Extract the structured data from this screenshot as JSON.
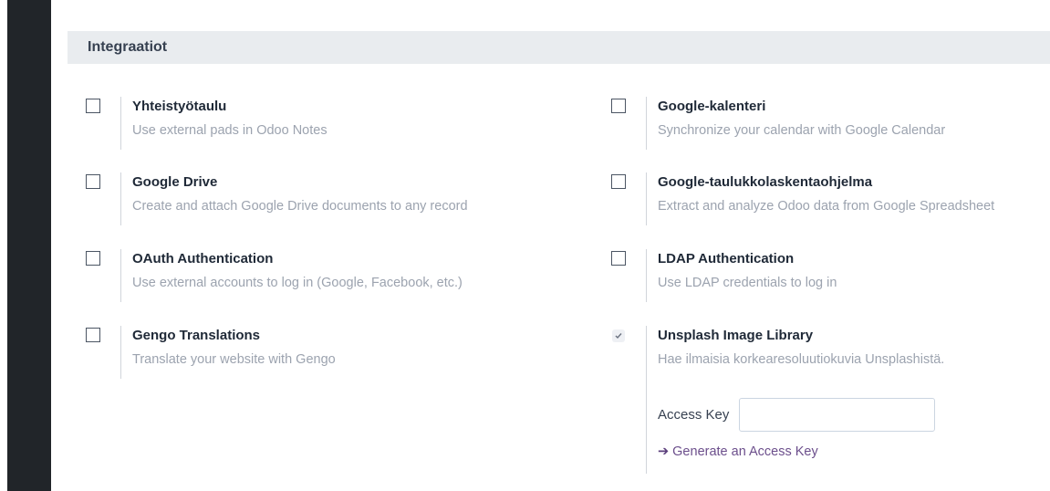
{
  "section": {
    "title": "Integraatiot"
  },
  "left_settings": [
    {
      "title": "Yhteistyötaulu",
      "description": "Use external pads in Odoo Notes",
      "checked": false
    },
    {
      "title": "Google Drive",
      "description": "Create and attach Google Drive documents to any record",
      "checked": false
    },
    {
      "title": "OAuth Authentication",
      "description": "Use external accounts to log in (Google, Facebook, etc.)",
      "checked": false
    },
    {
      "title": "Gengo Translations",
      "description": "Translate your website with Gengo",
      "checked": false
    }
  ],
  "right_settings": [
    {
      "title": "Google-kalenteri",
      "description": "Synchronize your calendar with Google Calendar",
      "checked": false
    },
    {
      "title": "Google-taulukkolaskentaohjelma",
      "description": "Extract and analyze Odoo data from Google Spreadsheet",
      "checked": false
    },
    {
      "title": "LDAP Authentication",
      "description": "Use LDAP credentials to log in",
      "checked": false
    },
    {
      "title": "Unsplash Image Library",
      "description": "Hae ilmaisia korkearesoluutiokuvia Unsplashistä.",
      "checked": true
    }
  ],
  "unsplash": {
    "access_key_label": "Access Key",
    "access_key_value": "",
    "generate_link": "Generate an Access Key"
  },
  "colors": {
    "sidebar": "#212529",
    "header_bg": "#e9ecef",
    "link": "#6c4f8c"
  }
}
